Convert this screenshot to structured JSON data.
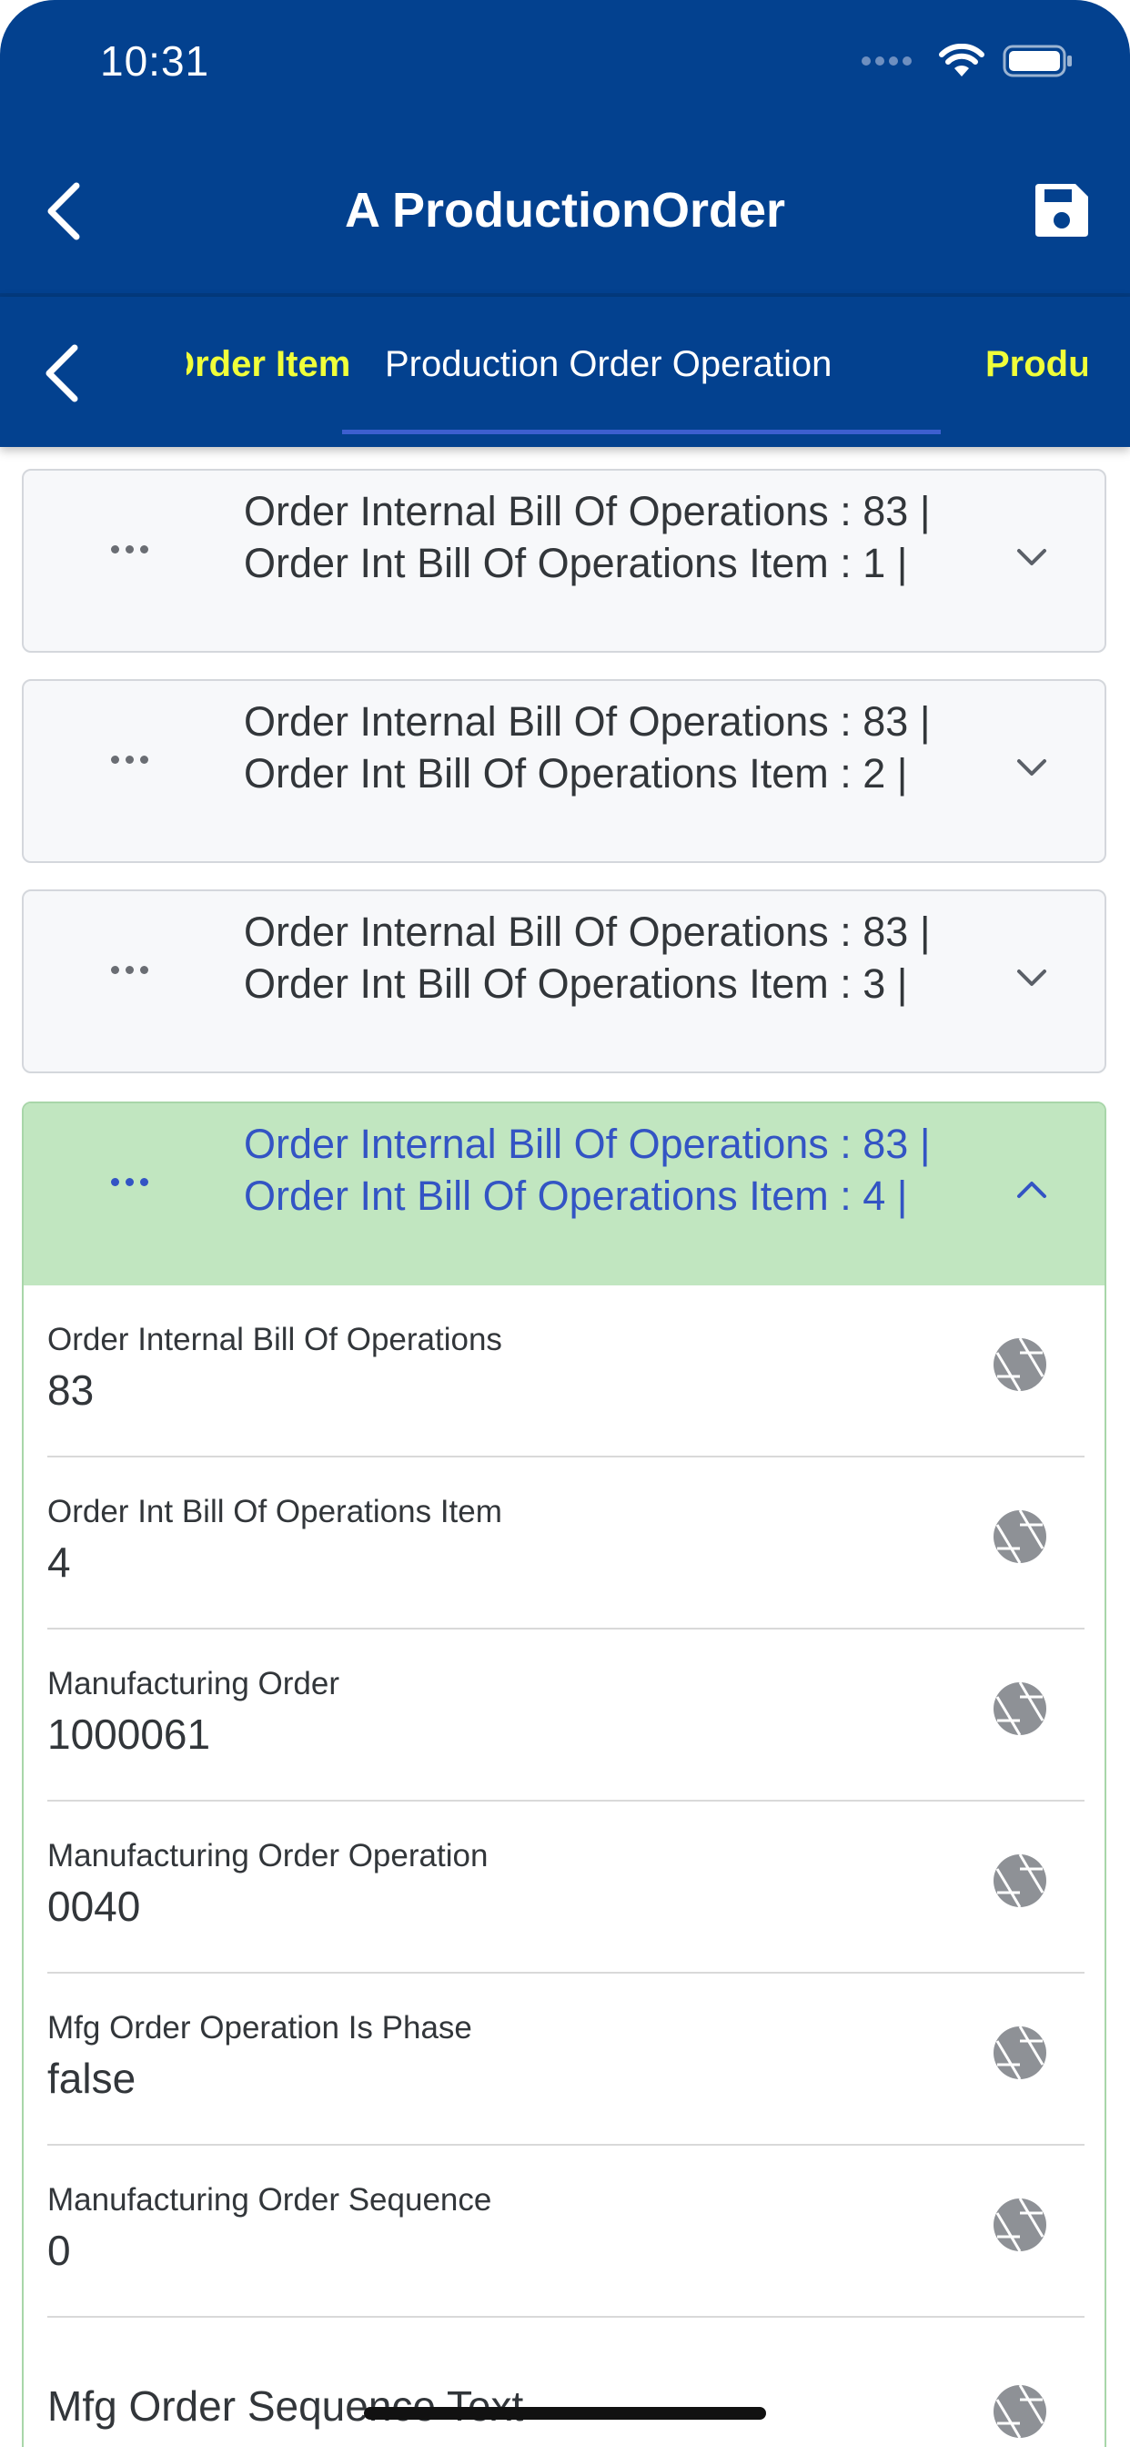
{
  "status_bar": {
    "time": "10:31"
  },
  "nav": {
    "title": "A ProductionOrder"
  },
  "tabs": {
    "prev": "Order Item",
    "active": "Production Order Operation",
    "next": "Production Order Component"
  },
  "collapsed_items": [
    {
      "title": "Order Internal Bill Of Operations : 83 | Order Int Bill Of Operations Item : 1 |"
    },
    {
      "title": "Order Internal Bill Of Operations : 83 | Order Int Bill Of Operations Item : 2 |"
    },
    {
      "title": "Order Internal Bill Of Operations : 83 | Order Int Bill Of Operations Item : 3 |"
    }
  ],
  "expanded_item": {
    "title": "Order Internal Bill Of Operations : 83 | Order Int Bill Of Operations Item : 4 |",
    "fields": [
      {
        "label": "Order Internal Bill Of Operations",
        "value": "83"
      },
      {
        "label": "Order Int Bill Of Operations Item",
        "value": "4"
      },
      {
        "label": "Manufacturing Order",
        "value": "1000061"
      },
      {
        "label": "Manufacturing Order Operation",
        "value": "0040"
      },
      {
        "label": "Mfg Order Operation Is Phase",
        "value": "false"
      },
      {
        "label": "Manufacturing Order Sequence",
        "value": "0"
      },
      {
        "label": "Mfg Order Sequence Text",
        "value": ""
      }
    ]
  },
  "colors": {
    "header": "#03418f",
    "tab_inactive": "#f0ff3a",
    "expanded_header": "#c1e6c0",
    "expanded_text": "#3354c4"
  },
  "icons": {
    "back": "chevron-left-icon",
    "save": "save-icon",
    "more": "more-horizontal-icon",
    "expand": "chevron-down-icon",
    "collapse": "chevron-up-icon",
    "field_action": "camera-shutter-icon"
  }
}
